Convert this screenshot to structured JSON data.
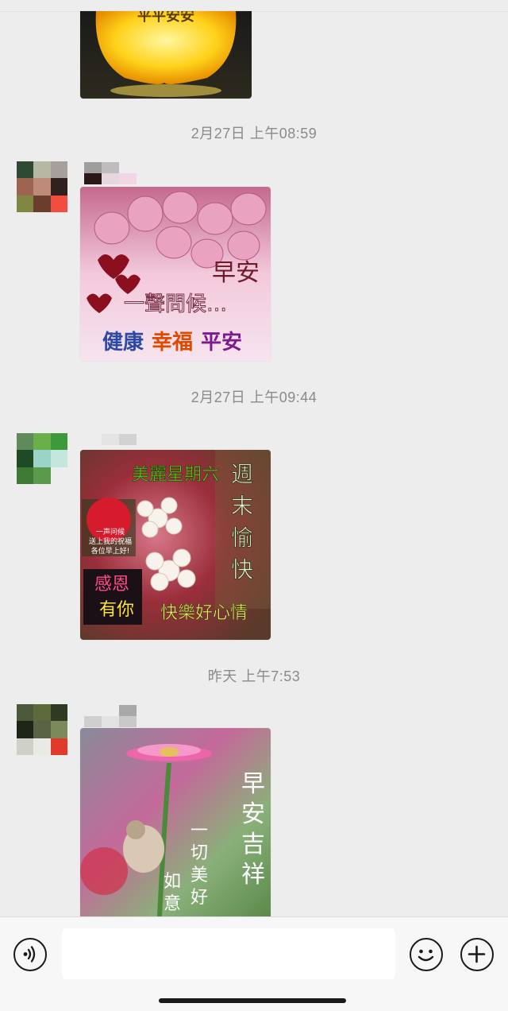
{
  "timestamps": [
    "2月27日 上午08:59",
    "2月27日 上午09:44",
    "昨天 上午7:53"
  ],
  "messages": [
    {
      "image_text": [
        "平平安安"
      ]
    },
    {
      "image_text": [
        "早安",
        "一聲問候…",
        "健康",
        "幸福",
        "平安"
      ]
    },
    {
      "image_text": [
        "美麗星期六",
        "週",
        "末",
        "愉",
        "快",
        "一声问候",
        "送上我的祝福",
        "各位早上好!",
        "感恩",
        "有你",
        "快樂好心情"
      ]
    },
    {
      "image_text": [
        "早",
        "安",
        "吉",
        "祥",
        "一",
        "切",
        "美",
        "好",
        "如",
        "意"
      ]
    }
  ],
  "input": {
    "voice_icon": "voice-icon",
    "emoji_icon": "emoji-icon",
    "add_icon": "plus-icon"
  }
}
